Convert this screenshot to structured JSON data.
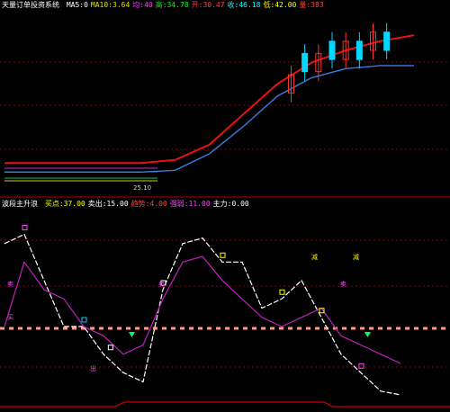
{
  "top_panel": {
    "title": "天量订单投资系统",
    "indicators": [
      {
        "label": "MA5:",
        "value": "0",
        "color": "#ffffff"
      },
      {
        "label": "MA10:",
        "value": "3.64",
        "color": "#e0e000"
      },
      {
        "label": "均:",
        "value": "40",
        "color": "#ff40ff"
      },
      {
        "label": "高:",
        "value": "34.78",
        "color": "#00ff00"
      },
      {
        "label": "开:",
        "value": "30.47",
        "color": "#ff4040"
      },
      {
        "label": "收:",
        "value": "46.18",
        "color": "#00ffff"
      },
      {
        "label": "低:",
        "value": "42.00",
        "color": "#ffff00"
      },
      {
        "label": "量:",
        "value": "383",
        "color": "#ff4040"
      }
    ],
    "price_label_left": "25.10",
    "colors": {
      "ma_red": "#e81010",
      "ma_blue": "#3a7be0",
      "candle_up": "#ff3030",
      "candle_down": "#00d8ff",
      "grid": "#8b0000"
    }
  },
  "bottom_panel": {
    "title": "波段主升浪",
    "indicators": [
      {
        "label": "买点:",
        "value": "37.00",
        "color": "#ffff00"
      },
      {
        "label": "卖出:",
        "value": "15.00",
        "color": "#ffffff"
      },
      {
        "label": "趋势:",
        "value": "4.00",
        "color": "#ff4040"
      },
      {
        "label": "强弱:",
        "value": "11.00",
        "color": "#ff40ff"
      },
      {
        "label": "主力:",
        "value": "0.00",
        "color": "#ffffff"
      }
    ],
    "markers": [
      "卖",
      "买",
      "出",
      "卖",
      "卖",
      "减",
      "减"
    ],
    "colors": {
      "line_white": "#ffffff",
      "line_magenta": "#c020c0",
      "dash_salmon": "#ff9a8a",
      "grid": "#8b0000",
      "border": "#b00000"
    }
  },
  "chart_data": [
    {
      "type": "line",
      "title": "天量订单投资系统",
      "x": [
        0,
        5,
        10,
        15,
        20,
        25,
        30,
        35,
        40,
        45,
        50,
        55,
        60
      ],
      "series": [
        {
          "values": [
            20,
            20,
            20,
            20,
            20,
            20.5,
            23,
            28,
            33,
            36.5,
            38.5,
            40,
            41
          ]
        },
        {
          "values": [
            18.5,
            18.5,
            18.5,
            18.5,
            18.5,
            18.8,
            21.5,
            26,
            31,
            34,
            35.5,
            36,
            36
          ]
        }
      ],
      "ylim": [
        15,
        45
      ]
    },
    {
      "type": "line",
      "title": "波段主升浪",
      "x": [
        0,
        3,
        6,
        9,
        12,
        15,
        18,
        21,
        24,
        27,
        30,
        33,
        36,
        39,
        42,
        45,
        48,
        51,
        54,
        57,
        60
      ],
      "series": [
        {
          "values": [
            85,
            90,
            65,
            40,
            40,
            25,
            15,
            10,
            60,
            85,
            88,
            75,
            75,
            50,
            55,
            65,
            45,
            25,
            15,
            5,
            3
          ]
        },
        {
          "values": [
            40,
            75,
            60,
            55,
            40,
            35,
            25,
            30,
            55,
            75,
            78,
            65,
            55,
            45,
            40,
            45,
            50,
            35,
            30,
            25,
            20
          ]
        }
      ],
      "ylim": [
        0,
        100
      ]
    }
  ]
}
